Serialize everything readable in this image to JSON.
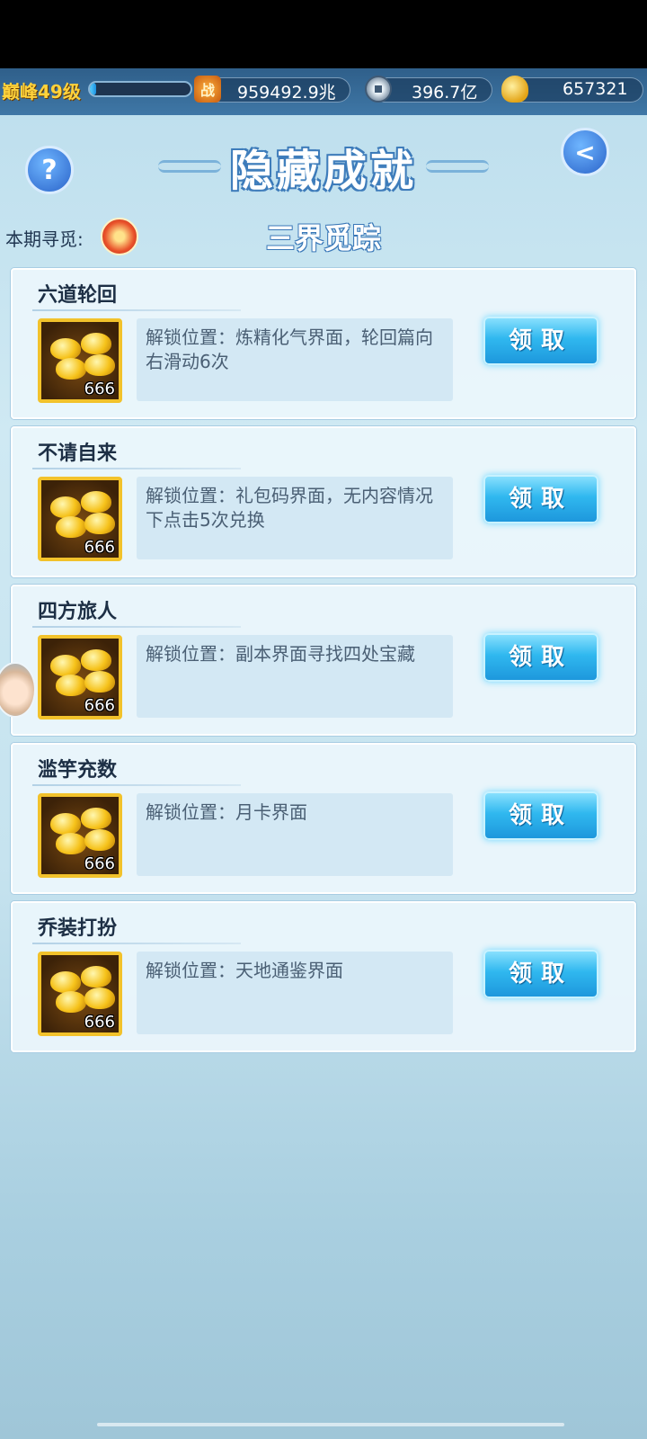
{
  "topbar": {
    "level": "巅峰49级",
    "exp_progress": 0.06,
    "power": "959492.9兆",
    "coins": "396.7亿",
    "ingots": "657321"
  },
  "header": {
    "title": "隐藏成就",
    "subtitle": "三界觅踪",
    "period_label": "本期寻觅:",
    "help_symbol": "?",
    "back_symbol": "<"
  },
  "icons": {
    "power": "战",
    "coin": "coin-icon",
    "ingot": "gold-ingot-icon"
  },
  "achievements": [
    {
      "title": "六道轮回",
      "reward_count": "666",
      "desc": "解锁位置：炼精化气界面，轮回篇向右滑动6次",
      "button": "领取"
    },
    {
      "title": "不请自来",
      "reward_count": "666",
      "desc": "解锁位置：礼包码界面，无内容情况下点击5次兑换",
      "button": "领取"
    },
    {
      "title": "四方旅人",
      "reward_count": "666",
      "desc": "解锁位置：副本界面寻找四处宝藏",
      "button": "领取"
    },
    {
      "title": "滥竽充数",
      "reward_count": "666",
      "desc": "解锁位置：月卡界面",
      "button": "领取"
    },
    {
      "title": "乔装打扮",
      "reward_count": "666",
      "desc": "解锁位置：天地通鉴界面",
      "button": "领取"
    }
  ]
}
